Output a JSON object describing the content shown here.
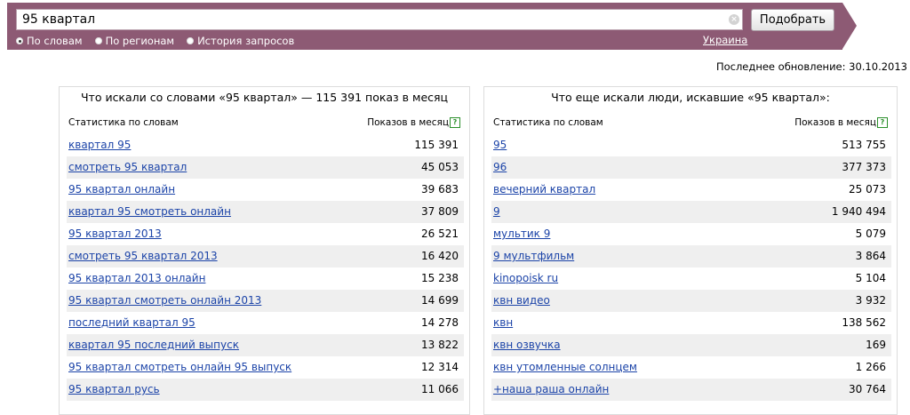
{
  "search": {
    "value": "95 квартал",
    "submit_label": "Подобрать",
    "clear_glyph": "×"
  },
  "modes": [
    {
      "label": "По словам",
      "checked": true
    },
    {
      "label": "По регионам",
      "checked": false
    },
    {
      "label": "История запросов",
      "checked": false
    }
  ],
  "region": "Украина",
  "last_update": "Последнее обновление: 30.10.2013",
  "left": {
    "title": "Что искали со словами «95 квартал» — 115 391 показ в месяц",
    "col_query": "Статистика по словам",
    "col_count": "Показов в месяц",
    "help": "?",
    "rows": [
      {
        "query": "квартал 95",
        "count": "115 391"
      },
      {
        "query": "смотреть 95 квартал",
        "count": "45 053"
      },
      {
        "query": "95 квартал онлайн",
        "count": "39 683"
      },
      {
        "query": "квартал 95 смотреть онлайн",
        "count": "37 809"
      },
      {
        "query": "95 квартал 2013",
        "count": "26 521"
      },
      {
        "query": "смотреть 95 квартал 2013",
        "count": "16 420"
      },
      {
        "query": "95 квартал 2013 онлайн",
        "count": "15 238"
      },
      {
        "query": "95 квартал смотреть онлайн 2013",
        "count": "14 699"
      },
      {
        "query": "последний квартал 95",
        "count": "14 278"
      },
      {
        "query": "квартал 95 последний выпуск",
        "count": "13 822"
      },
      {
        "query": "95 квартал смотреть онлайн 95 выпуск",
        "count": "12 314"
      },
      {
        "query": "95 квартал русь",
        "count": "11 066"
      }
    ]
  },
  "right": {
    "title": "Что еще искали люди, искавшие «95 квартал»:",
    "col_query": "Статистика по словам",
    "col_count": "Показов в месяц",
    "help": "?",
    "rows": [
      {
        "query": "95",
        "count": "513 755"
      },
      {
        "query": "96",
        "count": "377 373"
      },
      {
        "query": "вечерний квартал",
        "count": "25 073"
      },
      {
        "query": "9",
        "count": "1 940 494"
      },
      {
        "query": "мультик 9",
        "count": "5 079"
      },
      {
        "query": "9 мультфильм",
        "count": "3 864"
      },
      {
        "query": "kinopoisk ru",
        "count": "5 104"
      },
      {
        "query": "квн видео",
        "count": "3 932"
      },
      {
        "query": "квн",
        "count": "138 562"
      },
      {
        "query": "квн озвучка",
        "count": "169"
      },
      {
        "query": "квн утомленные солнцем",
        "count": "1 266"
      },
      {
        "query": "+наша раша онлайн",
        "count": "30 764"
      }
    ]
  }
}
